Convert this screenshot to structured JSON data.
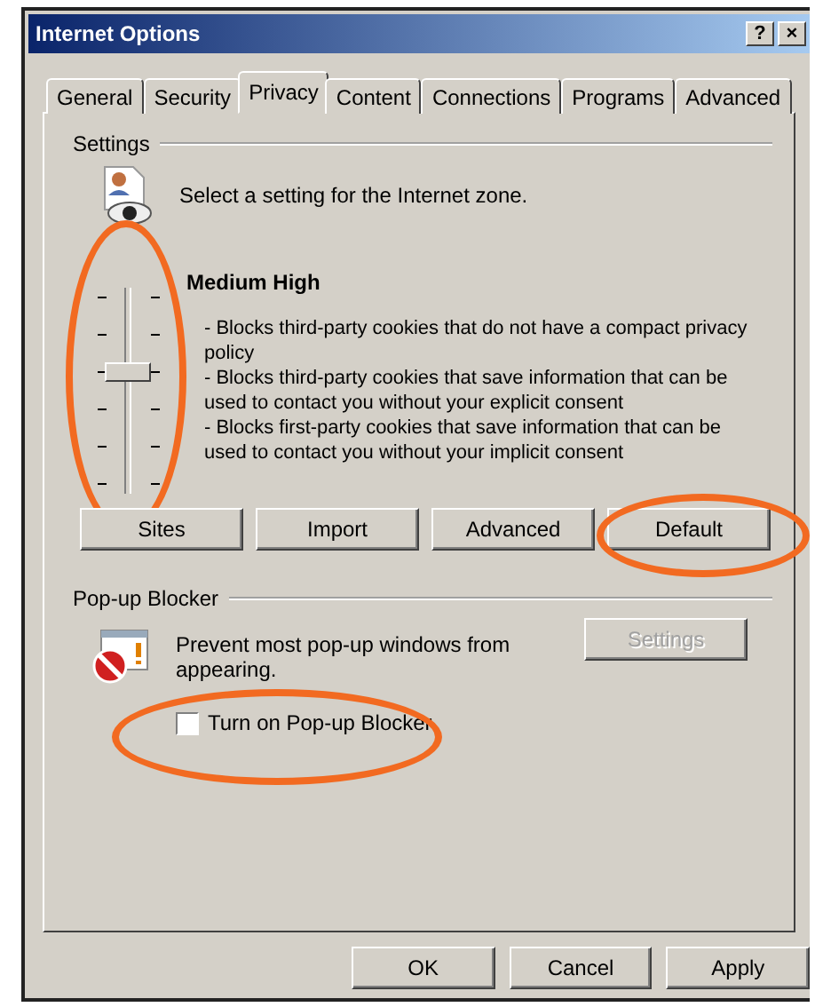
{
  "window": {
    "title": "Internet Options",
    "help_button": "?",
    "close_button": "×"
  },
  "tabs": [
    {
      "label": "General",
      "selected": false
    },
    {
      "label": "Security",
      "selected": false
    },
    {
      "label": "Privacy",
      "selected": true
    },
    {
      "label": "Content",
      "selected": false
    },
    {
      "label": "Connections",
      "selected": false
    },
    {
      "label": "Programs",
      "selected": false
    },
    {
      "label": "Advanced",
      "selected": false
    }
  ],
  "settings": {
    "heading": "Settings",
    "intro": "Select a setting for the Internet zone.",
    "slider": {
      "level": 0.6,
      "circled": true
    },
    "level_name": "Medium High",
    "description": [
      "- Blocks third-party cookies that do not have a compact privacy policy",
      "- Blocks third-party cookies that save information that can be used to contact you without your explicit consent",
      "- Blocks first-party cookies that save information that can be used to contact you without your implicit consent"
    ],
    "buttons": [
      {
        "label": "Sites",
        "circled": false
      },
      {
        "label": "Import",
        "circled": false
      },
      {
        "label": "Advanced",
        "circled": false
      },
      {
        "label": "Default",
        "circled": true
      }
    ]
  },
  "popup_blocker": {
    "heading": "Pop-up Blocker",
    "text": "Prevent most pop-up windows from",
    "text_line_2": "appearing.",
    "settings_button": {
      "label": "Settings",
      "disabled": true
    },
    "checkbox": {
      "label": "Turn on Pop-up Blocker",
      "checked": false,
      "circled": true
    }
  },
  "buttons": [
    "OK",
    "Cancel",
    "Apply"
  ]
}
